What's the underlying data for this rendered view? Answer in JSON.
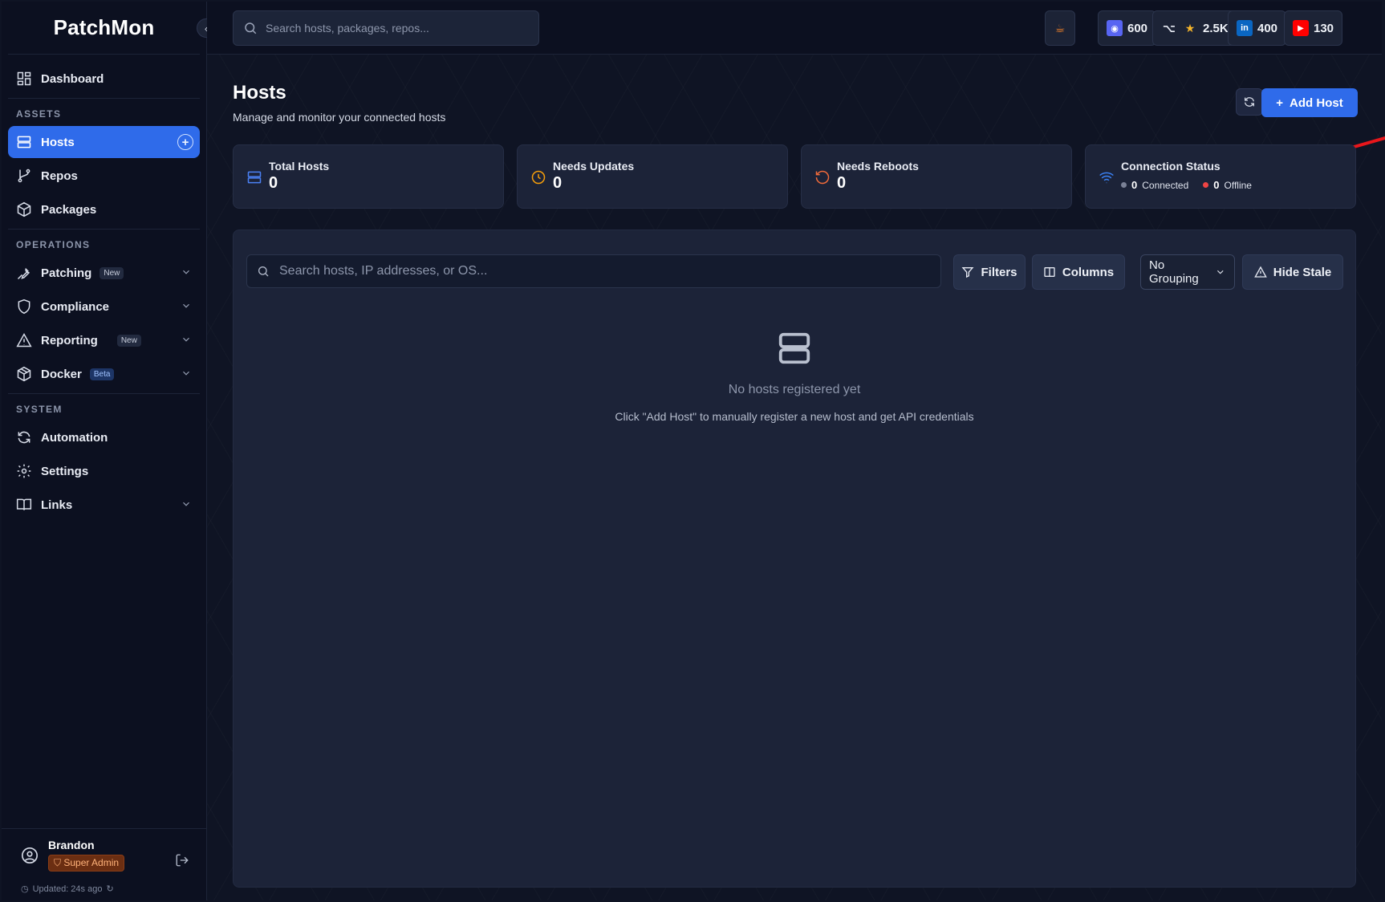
{
  "brand": "PatchMon",
  "search": {
    "placeholder": "Search hosts, packages, repos..."
  },
  "socials": {
    "discord": "600",
    "github": "2.5K",
    "linkedin": "400",
    "youtube": "130"
  },
  "sidebar": {
    "dashboard": "Dashboard",
    "sections": {
      "assets": "ASSETS",
      "operations": "OPERATIONS",
      "system": "SYSTEM"
    },
    "hosts": "Hosts",
    "repos": "Repos",
    "packages": "Packages",
    "patching": "Patching",
    "patching_badge": "New",
    "compliance": "Compliance",
    "reporting": "Reporting",
    "reporting_badge": "New",
    "docker": "Docker",
    "docker_badge": "Beta",
    "automation": "Automation",
    "settings": "Settings",
    "links": "Links"
  },
  "user": {
    "name": "Brandon",
    "role": "Super Admin",
    "updated": "Updated: 24s ago"
  },
  "page": {
    "title": "Hosts",
    "subtitle": "Manage and monitor your connected hosts",
    "add_label": "Add Host"
  },
  "stats": {
    "total_label": "Total Hosts",
    "total_value": "0",
    "updates_label": "Needs Updates",
    "updates_value": "0",
    "reboots_label": "Needs Reboots",
    "reboots_value": "0",
    "conn_label": "Connection Status",
    "connected_value": "0",
    "connected_label": "Connected",
    "offline_value": "0",
    "offline_label": "Offline"
  },
  "panel": {
    "search_placeholder": "Search hosts, IP addresses, or OS...",
    "filters": "Filters",
    "columns": "Columns",
    "grouping": "No Grouping",
    "hide_stale": "Hide Stale"
  },
  "empty": {
    "title": "No hosts registered yet",
    "subtitle": "Click \"Add Host\" to manually register a new host and get API credentials"
  },
  "colors": {
    "accent": "#2f6bea",
    "annotation": "#e8161b",
    "warning": "#f59e0b",
    "danger": "#ef4444"
  }
}
